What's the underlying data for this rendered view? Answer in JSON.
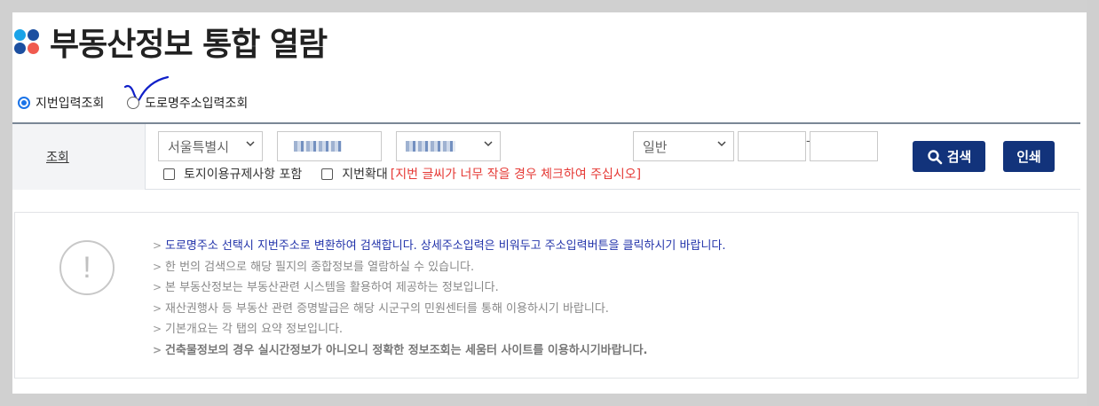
{
  "header": {
    "title": "부동산정보 통합 열람"
  },
  "lookup_mode": {
    "options": [
      {
        "label": "지번입력조회",
        "selected": true
      },
      {
        "label": "도로명주소입력조회",
        "selected": false
      }
    ]
  },
  "search": {
    "label": "조회",
    "city_select": "서울특별시",
    "land_type_select": "일반",
    "main_number_value": "",
    "sub_number_value": "",
    "dash": "-",
    "search_button": "검색",
    "print_button": "인쇄",
    "checkbox_land_use": "토지이용규제사항 포함",
    "checkbox_enlarge": "지번확대",
    "checkbox_enlarge_note": "[지번 글씨가 너무 작을 경우 체크하여 주십시오]"
  },
  "info": {
    "items": [
      "도로명주소 선택시 지번주소로 변환하여 검색합니다. 상세주소입력은 비워두고 주소입력버튼을 클릭하시기 바랍니다.",
      "한 번의 검색으로 해당 필지의 종합정보를 열람하실 수 있습니다.",
      "본 부동산정보는 부동산관련 시스템을 활용하여 제공하는 정보입니다.",
      "재산권행사 등 부동산 관련 증명발급은 해당 시군구의 민원센터를 통해 이용하시기 바랍니다.",
      "기본개요는 각 탭의 요약 정보입니다.",
      "건축물정보의 경우 실시간정보가 아니오니 정확한 정보조회는 세움터 사이트를 이용하시기바랍니다."
    ],
    "bullet": ">",
    "icon_symbol": "!"
  },
  "colors": {
    "accent": "#12337b",
    "radio": "#1a73e8",
    "warning": "#e53935",
    "info_highlight": "#2233aa"
  }
}
